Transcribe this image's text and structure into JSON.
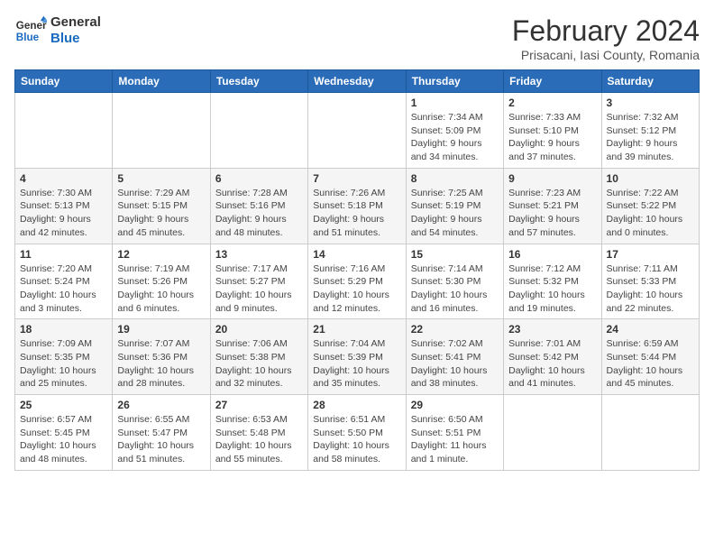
{
  "header": {
    "logo_line1": "General",
    "logo_line2": "Blue",
    "month_year": "February 2024",
    "location": "Prisacani, Iasi County, Romania"
  },
  "days_of_week": [
    "Sunday",
    "Monday",
    "Tuesday",
    "Wednesday",
    "Thursday",
    "Friday",
    "Saturday"
  ],
  "weeks": [
    [
      {
        "day": "",
        "info": ""
      },
      {
        "day": "",
        "info": ""
      },
      {
        "day": "",
        "info": ""
      },
      {
        "day": "",
        "info": ""
      },
      {
        "day": "1",
        "info": "Sunrise: 7:34 AM\nSunset: 5:09 PM\nDaylight: 9 hours and 34 minutes."
      },
      {
        "day": "2",
        "info": "Sunrise: 7:33 AM\nSunset: 5:10 PM\nDaylight: 9 hours and 37 minutes."
      },
      {
        "day": "3",
        "info": "Sunrise: 7:32 AM\nSunset: 5:12 PM\nDaylight: 9 hours and 39 minutes."
      }
    ],
    [
      {
        "day": "4",
        "info": "Sunrise: 7:30 AM\nSunset: 5:13 PM\nDaylight: 9 hours and 42 minutes."
      },
      {
        "day": "5",
        "info": "Sunrise: 7:29 AM\nSunset: 5:15 PM\nDaylight: 9 hours and 45 minutes."
      },
      {
        "day": "6",
        "info": "Sunrise: 7:28 AM\nSunset: 5:16 PM\nDaylight: 9 hours and 48 minutes."
      },
      {
        "day": "7",
        "info": "Sunrise: 7:26 AM\nSunset: 5:18 PM\nDaylight: 9 hours and 51 minutes."
      },
      {
        "day": "8",
        "info": "Sunrise: 7:25 AM\nSunset: 5:19 PM\nDaylight: 9 hours and 54 minutes."
      },
      {
        "day": "9",
        "info": "Sunrise: 7:23 AM\nSunset: 5:21 PM\nDaylight: 9 hours and 57 minutes."
      },
      {
        "day": "10",
        "info": "Sunrise: 7:22 AM\nSunset: 5:22 PM\nDaylight: 10 hours and 0 minutes."
      }
    ],
    [
      {
        "day": "11",
        "info": "Sunrise: 7:20 AM\nSunset: 5:24 PM\nDaylight: 10 hours and 3 minutes."
      },
      {
        "day": "12",
        "info": "Sunrise: 7:19 AM\nSunset: 5:26 PM\nDaylight: 10 hours and 6 minutes."
      },
      {
        "day": "13",
        "info": "Sunrise: 7:17 AM\nSunset: 5:27 PM\nDaylight: 10 hours and 9 minutes."
      },
      {
        "day": "14",
        "info": "Sunrise: 7:16 AM\nSunset: 5:29 PM\nDaylight: 10 hours and 12 minutes."
      },
      {
        "day": "15",
        "info": "Sunrise: 7:14 AM\nSunset: 5:30 PM\nDaylight: 10 hours and 16 minutes."
      },
      {
        "day": "16",
        "info": "Sunrise: 7:12 AM\nSunset: 5:32 PM\nDaylight: 10 hours and 19 minutes."
      },
      {
        "day": "17",
        "info": "Sunrise: 7:11 AM\nSunset: 5:33 PM\nDaylight: 10 hours and 22 minutes."
      }
    ],
    [
      {
        "day": "18",
        "info": "Sunrise: 7:09 AM\nSunset: 5:35 PM\nDaylight: 10 hours and 25 minutes."
      },
      {
        "day": "19",
        "info": "Sunrise: 7:07 AM\nSunset: 5:36 PM\nDaylight: 10 hours and 28 minutes."
      },
      {
        "day": "20",
        "info": "Sunrise: 7:06 AM\nSunset: 5:38 PM\nDaylight: 10 hours and 32 minutes."
      },
      {
        "day": "21",
        "info": "Sunrise: 7:04 AM\nSunset: 5:39 PM\nDaylight: 10 hours and 35 minutes."
      },
      {
        "day": "22",
        "info": "Sunrise: 7:02 AM\nSunset: 5:41 PM\nDaylight: 10 hours and 38 minutes."
      },
      {
        "day": "23",
        "info": "Sunrise: 7:01 AM\nSunset: 5:42 PM\nDaylight: 10 hours and 41 minutes."
      },
      {
        "day": "24",
        "info": "Sunrise: 6:59 AM\nSunset: 5:44 PM\nDaylight: 10 hours and 45 minutes."
      }
    ],
    [
      {
        "day": "25",
        "info": "Sunrise: 6:57 AM\nSunset: 5:45 PM\nDaylight: 10 hours and 48 minutes."
      },
      {
        "day": "26",
        "info": "Sunrise: 6:55 AM\nSunset: 5:47 PM\nDaylight: 10 hours and 51 minutes."
      },
      {
        "day": "27",
        "info": "Sunrise: 6:53 AM\nSunset: 5:48 PM\nDaylight: 10 hours and 55 minutes."
      },
      {
        "day": "28",
        "info": "Sunrise: 6:51 AM\nSunset: 5:50 PM\nDaylight: 10 hours and 58 minutes."
      },
      {
        "day": "29",
        "info": "Sunrise: 6:50 AM\nSunset: 5:51 PM\nDaylight: 11 hours and 1 minute."
      },
      {
        "day": "",
        "info": ""
      },
      {
        "day": "",
        "info": ""
      }
    ]
  ]
}
